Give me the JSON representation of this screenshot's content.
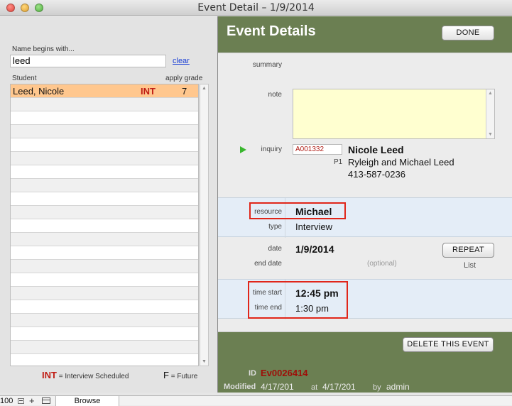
{
  "window": {
    "title": "Event Detail  –  1/9/2014"
  },
  "search": {
    "label": "Name begins with...",
    "value": "leed",
    "clear_label": "clear"
  },
  "list": {
    "header_student": "Student",
    "header_grade": "apply grade",
    "rows": [
      {
        "name": "Leed, Nicole",
        "code": "INT",
        "grade": "7",
        "selected": true
      }
    ]
  },
  "legend": {
    "int_code": "INT",
    "int_text": "= Interview Scheduled",
    "f_code": "F",
    "f_text": "= Future"
  },
  "event": {
    "title": "Event Details",
    "done_label": "DONE",
    "summary_label": "summary",
    "note_label": "note",
    "inquiry_label": "inquiry",
    "inquiry_id": "A001332",
    "p1_label": "P1",
    "person_name": "Nicole Leed",
    "parents": "Ryleigh and Michael Leed",
    "phone": "413-587-0236",
    "resource_label": "resource",
    "resource_value": "Michael",
    "type_label": "type",
    "type_value": "Interview",
    "date_label": "date",
    "date_value": "1/9/2014",
    "end_date_label": "end date",
    "end_date_placeholder": "(optional)",
    "repeat_label": "REPEAT",
    "list_label": "List",
    "time_start_label": "time start",
    "time_start_value": "12:45 pm",
    "time_end_label": "time end",
    "time_end_value": "1:30 pm",
    "delete_label": "DELETE THIS EVENT",
    "id_label": "ID",
    "id_value": "Ev0026414",
    "modified_label": "Modified",
    "modified_date": "4/17/201",
    "at_label": "at",
    "at_value": "4/17/201",
    "by_label": "by",
    "by_value": "admin"
  },
  "statusbar": {
    "zoom": "100",
    "mode": "Browse"
  },
  "colors": {
    "panel_green": "#6b7f52",
    "highlight_red": "#e0261a",
    "selected_row": "#ffc78e",
    "note_bg": "#ffffd0"
  }
}
